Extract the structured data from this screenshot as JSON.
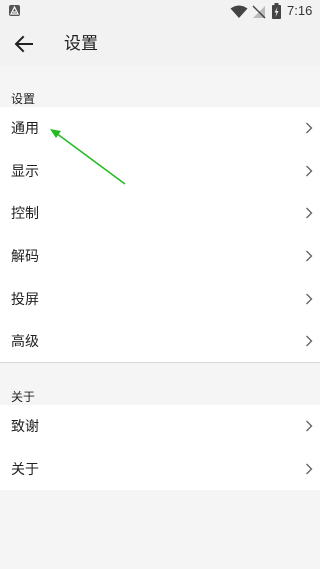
{
  "status_bar": {
    "time": "7:16",
    "icons": [
      "notification-icon",
      "wifi-icon",
      "no-signal-icon",
      "battery-charging-icon"
    ]
  },
  "app_bar": {
    "title": "设置",
    "back_icon": "arrow-back-icon"
  },
  "sections": [
    {
      "header": "设置",
      "items": [
        {
          "label": "通用"
        },
        {
          "label": "显示"
        },
        {
          "label": "控制"
        },
        {
          "label": "解码"
        },
        {
          "label": "投屏"
        },
        {
          "label": "高级"
        }
      ]
    },
    {
      "header": "关于",
      "items": [
        {
          "label": "致谢"
        },
        {
          "label": "关于"
        }
      ]
    }
  ],
  "colors": {
    "annotation_arrow": "#22bb22",
    "background": "#f5f5f5",
    "list_background": "#ffffff"
  },
  "icons": {
    "chevron": "chevron-right-icon",
    "annotation": "annotation-arrow-icon"
  }
}
